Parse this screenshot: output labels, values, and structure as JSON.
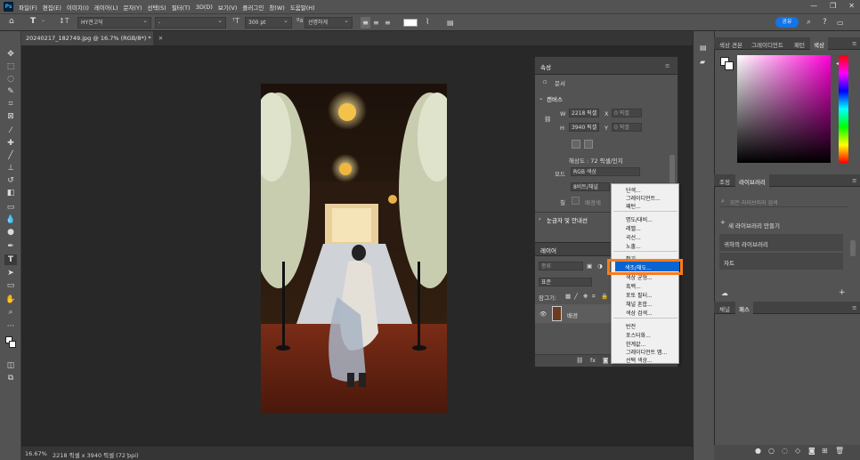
{
  "menubar": {
    "items": [
      "파일(F)",
      "편집(E)",
      "이미지(I)",
      "레이어(L)",
      "문자(Y)",
      "선택(S)",
      "필터(T)",
      "3D(D)",
      "보기(V)",
      "플러그인",
      "창(W)",
      "도움말(H)"
    ],
    "minimize": "—",
    "restore": "❐",
    "close": "✕"
  },
  "options": {
    "font_family": "HY견고딕",
    "font_style": "-",
    "font_size": "300 pt",
    "antialias": "선명하게",
    "share_label": "공유"
  },
  "document": {
    "tab_title": "20240217_182749.jpg @ 16.7% (RGB/8*) *",
    "zoom": "16.67%",
    "size_info": "2218 픽셀 x 3940 픽셀 (72 ppi)"
  },
  "properties": {
    "tab": "속성",
    "doc_label": "문서",
    "canvas_section": "캔버스",
    "w_label": "W",
    "w_value": "2218 픽셀",
    "x_label": "X",
    "x_value": "0 픽셀",
    "h_label": "H",
    "h_value": "3940 픽셀",
    "y_label": "Y",
    "y_value": "0 픽셀",
    "resolution": "해상도 : 72 픽셀/인치",
    "mode_label": "모드",
    "mode_value": "RGB 색상",
    "depth_value": "8비트/채널",
    "fill_label": "칠",
    "fill_value": "배경색",
    "rulers_section": "눈금자 및 안내선"
  },
  "layers": {
    "tab": "레이어",
    "filter_placeholder": "종류",
    "blend_mode": "표준",
    "lock_label": "잠그기:",
    "layer_name": "배경"
  },
  "context_menu": {
    "items": [
      "단색...",
      "그레이디언트...",
      "패턴...",
      "명도/대비...",
      "레벨...",
      "곡선...",
      "노출...",
      "활기...",
      "색조/채도...",
      "색상 균형...",
      "흑백...",
      "포토 필터...",
      "채널 혼합...",
      "색상 검색...",
      "반전",
      "포스터화...",
      "한계값...",
      "그레이디언트 맵...",
      "선택 색상..."
    ],
    "highlighted": "색조/채도..."
  },
  "right_panel": {
    "color_tabs": [
      "색상 견본",
      "그레이디언트",
      "패턴",
      "색상"
    ],
    "lib_tabs": [
      "조정",
      "라이브러리"
    ],
    "lib_search_placeholder": "모든 라이브러리 검색",
    "new_library": "새 라이브러리 만들기",
    "libraries": [
      "귀하의 라이브러리",
      "자트"
    ],
    "channel_tabs": [
      "채널",
      "패스"
    ]
  },
  "colors": {
    "highlight": "#0a64d0",
    "annotation_box": "#ff7a1a",
    "share_button": "#1473e6"
  }
}
